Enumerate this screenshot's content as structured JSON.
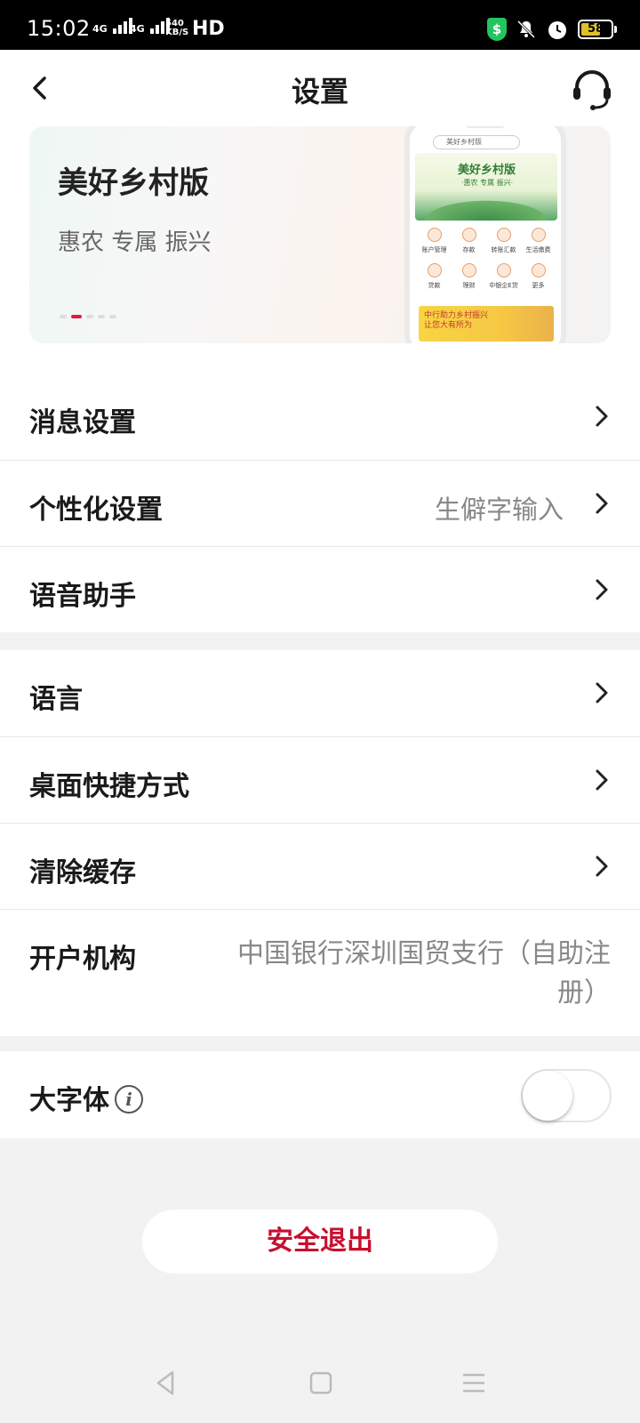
{
  "status_bar": {
    "time": "15:02",
    "network_1": "4G",
    "network_2": "4G",
    "rate": "540 KB/S",
    "hd": "HD",
    "battery": "58"
  },
  "header": {
    "title": "设置"
  },
  "banner": {
    "title": "美好乡村版",
    "subtitle": "惠农 专属 振兴",
    "active_dot": 1,
    "dot_count": 5,
    "phone_search": "美好乡村版",
    "phone_hero_title": "美好乡村版",
    "phone_hero_sub": "·惠农 专属 振兴·",
    "phone_grid": [
      "账户管理",
      "存款",
      "转账汇款",
      "生活缴费",
      "贷款",
      "理财",
      "中银企E贷",
      "更多"
    ],
    "phone_promo_1": "中行助力乡村振兴",
    "phone_promo_2": "让您大有所为"
  },
  "group1": {
    "items": [
      {
        "label": "消息设置",
        "value": ""
      },
      {
        "label": "个性化设置",
        "value": "生僻字输入"
      },
      {
        "label": "语音助手",
        "value": ""
      }
    ]
  },
  "group2": {
    "items": [
      {
        "label": "语言"
      },
      {
        "label": "桌面快捷方式"
      },
      {
        "label": "清除缓存"
      }
    ],
    "branch_label": "开户机构",
    "branch_value": "中国银行深圳国贸支行（自助注册）"
  },
  "group3": {
    "large_font_label": "大字体",
    "large_font_on": false
  },
  "logout_label": "安全退出",
  "colors": {
    "accent": "#c8102e",
    "dot_active": "#e31b3c"
  }
}
